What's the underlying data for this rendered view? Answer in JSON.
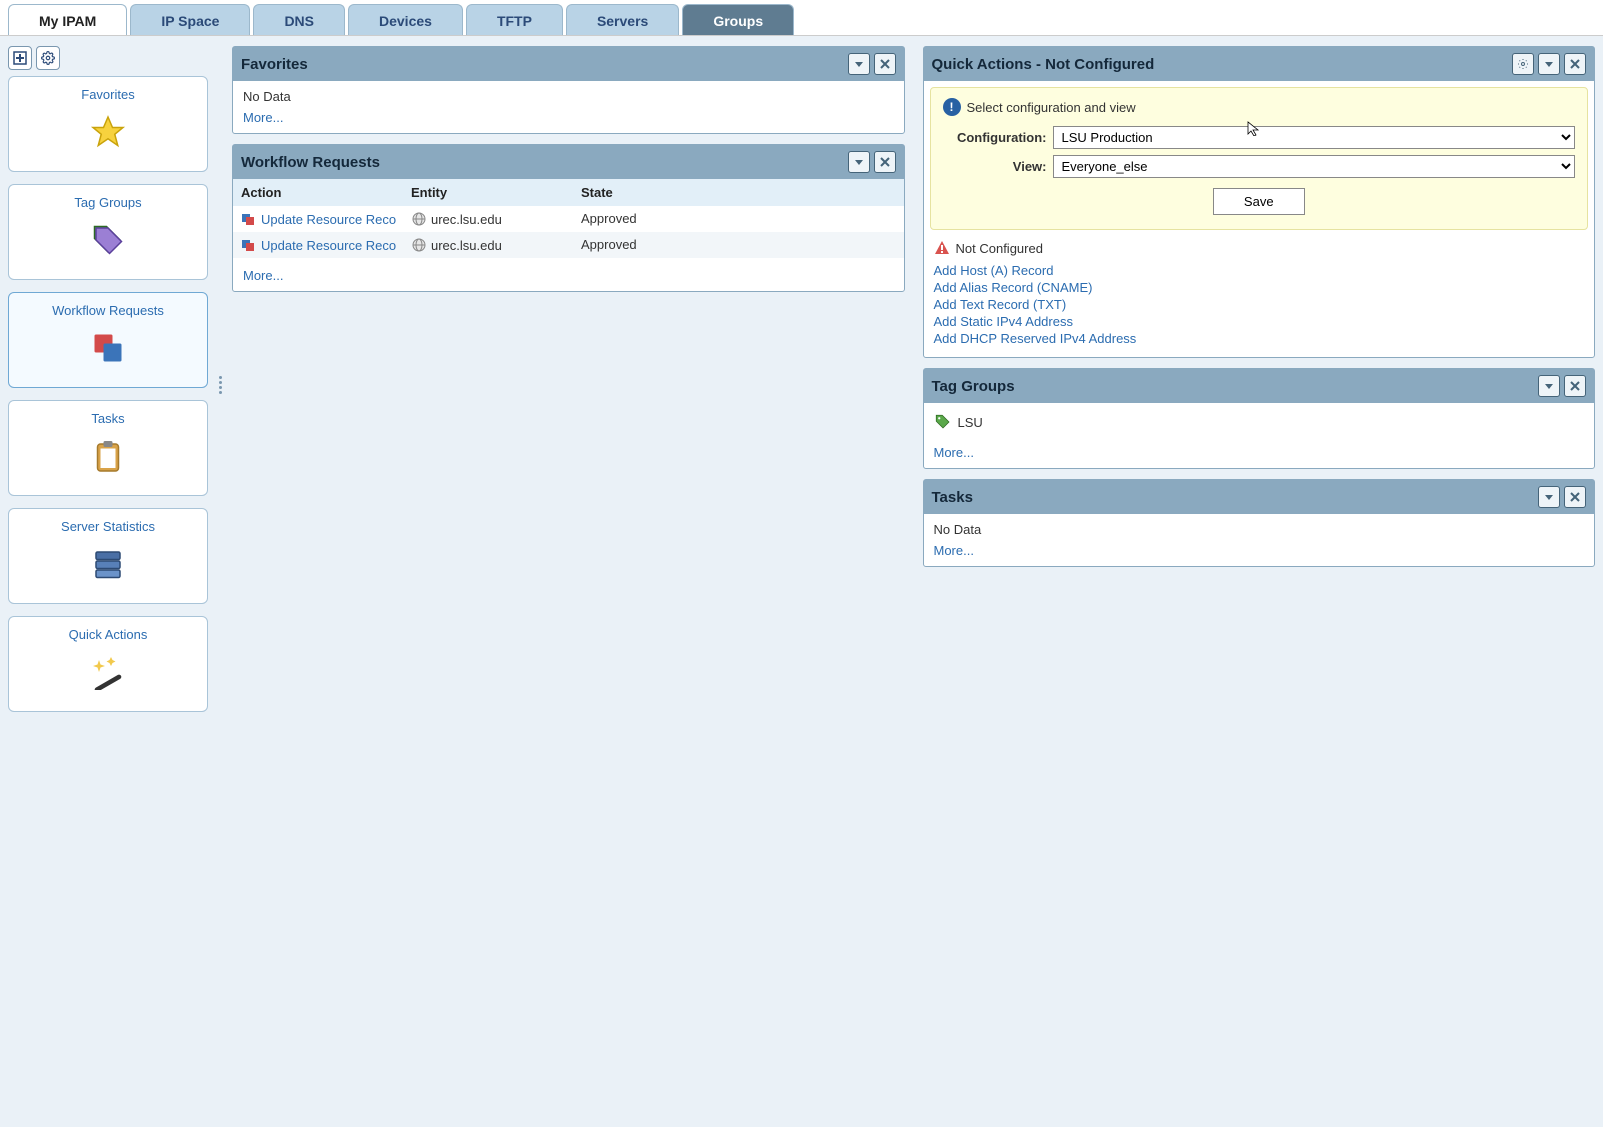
{
  "tabs": [
    "My IPAM",
    "IP Space",
    "DNS",
    "Devices",
    "TFTP",
    "Servers",
    "Groups"
  ],
  "active_tab": 0,
  "dark_tab": 6,
  "sidebar": {
    "items": [
      {
        "label": "Favorites",
        "icon": "star"
      },
      {
        "label": "Tag Groups",
        "icon": "tags"
      },
      {
        "label": "Workflow Requests",
        "icon": "workflow"
      },
      {
        "label": "Tasks",
        "icon": "clipboard"
      },
      {
        "label": "Server Statistics",
        "icon": "server"
      },
      {
        "label": "Quick Actions",
        "icon": "wand"
      }
    ],
    "selected": 2
  },
  "favorites_panel": {
    "title": "Favorites",
    "no_data": "No Data",
    "more": "More..."
  },
  "workflow_panel": {
    "title": "Workflow Requests",
    "columns": [
      "Action",
      "Entity",
      "State"
    ],
    "rows": [
      {
        "action": "Update Resource Reco",
        "entity": "urec.lsu.edu",
        "state": "Approved"
      },
      {
        "action": "Update Resource Reco",
        "entity": "urec.lsu.edu",
        "state": "Approved"
      }
    ],
    "more": "More..."
  },
  "quick_actions_panel": {
    "title": "Quick Actions - Not Configured",
    "info_text": "Select configuration and view",
    "config_label": "Configuration:",
    "config_value": "LSU Production",
    "view_label": "View:",
    "view_value": "Everyone_else",
    "save_label": "Save",
    "not_configured": "Not Configured",
    "links": [
      "Add Host (A) Record",
      "Add Alias Record (CNAME)",
      "Add Text Record (TXT)",
      "Add Static IPv4 Address",
      "Add DHCP Reserved IPv4 Address"
    ]
  },
  "tag_groups_panel": {
    "title": "Tag Groups",
    "item": "LSU",
    "more": "More..."
  },
  "tasks_panel": {
    "title": "Tasks",
    "no_data": "No Data",
    "more": "More..."
  }
}
